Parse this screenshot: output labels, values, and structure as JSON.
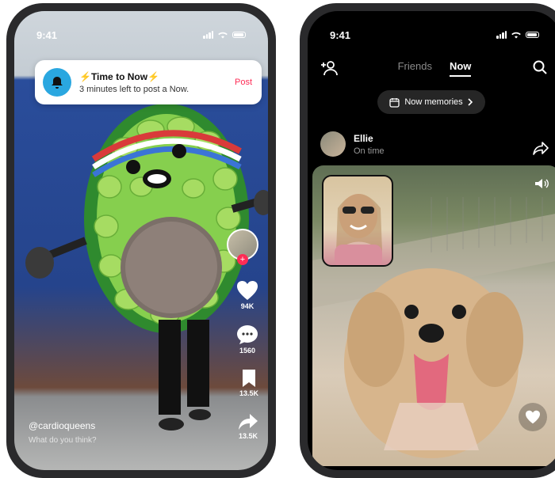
{
  "left_phone": {
    "status_time": "9:41",
    "notification": {
      "title": "⚡Time to Now⚡",
      "subtitle": "3 minutes left to post a Now.",
      "action": "Post"
    },
    "rail": {
      "likes": "94K",
      "comments": "1560",
      "saves": "13.5K",
      "shares": "13.5K"
    },
    "creator": {
      "username": "@cardioqueens",
      "caption": "What do you think?"
    }
  },
  "right_phone": {
    "status_time": "9:41",
    "tabs": [
      {
        "label": "Friends",
        "active": false
      },
      {
        "label": "Now",
        "active": true
      }
    ],
    "memories_label": "Now memories",
    "post": {
      "name": "Ellie",
      "status": "On time"
    }
  },
  "colors": {
    "accent_red": "#fe2c55",
    "notif_icon_bg": "#2aa7e0"
  }
}
